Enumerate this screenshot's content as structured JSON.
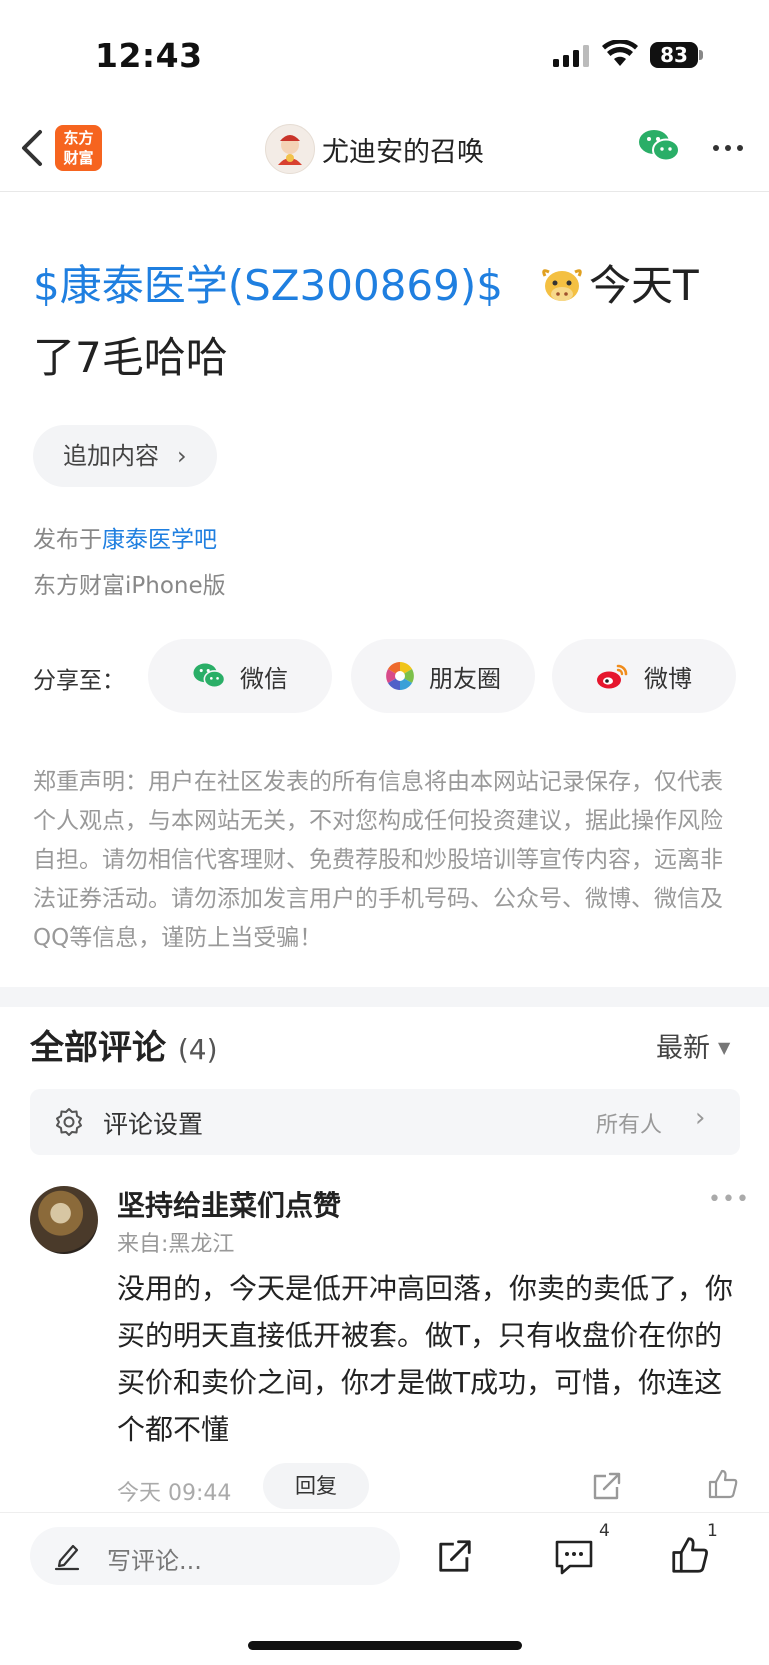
{
  "status_bar": {
    "time": "12:43",
    "battery": "83"
  },
  "nav": {
    "logo_line1": "东方",
    "logo_line2": "财富",
    "author": "尤迪安的召唤"
  },
  "post": {
    "stock_tag": "$康泰医学(SZ300869)$",
    "text_tail_1": "今天T",
    "text_tail_2": "了7毛哈哈",
    "add_content": "追加内容",
    "published_prefix": "发布于",
    "published_forum": "康泰医学吧",
    "client": "东方财富iPhone版"
  },
  "share": {
    "label": "分享至：",
    "wechat": "微信",
    "moments": "朋友圈",
    "weibo": "微博"
  },
  "disclaimer": "郑重声明：用户在社区发表的所有信息将由本网站记录保存，仅代表个人观点，与本网站无关，不对您构成任何投资建议，据此操作风险自担。请勿相信代客理财、免费荐股和炒股培训等宣传内容，远离非法证券活动。请勿添加发言用户的手机号码、公众号、微博、微信及QQ等信息，谨防上当受骗！",
  "comments": {
    "title": "全部评论",
    "count": "(4)",
    "sort": "最新",
    "settings_label": "评论设置",
    "settings_value": "所有人",
    "items": [
      {
        "name": "坚持给韭菜们点赞",
        "location": "来自:黑龙江",
        "body": "没用的，今天是低开冲高回落，你卖的卖低了，你买的明天直接低开被套。做T，只有收盘价在你的买价和卖价之间，你才是做T成功，可惜，你连这个都不懂",
        "time": "今天 09:44",
        "reply": "回复"
      }
    ]
  },
  "bottom_bar": {
    "placeholder": "写评论...",
    "comment_count": "4",
    "like_count": "1"
  },
  "colors": {
    "link_blue": "#1f7fe0",
    "brand_orange": "#f6641f",
    "wechat_green": "#2aae67"
  }
}
